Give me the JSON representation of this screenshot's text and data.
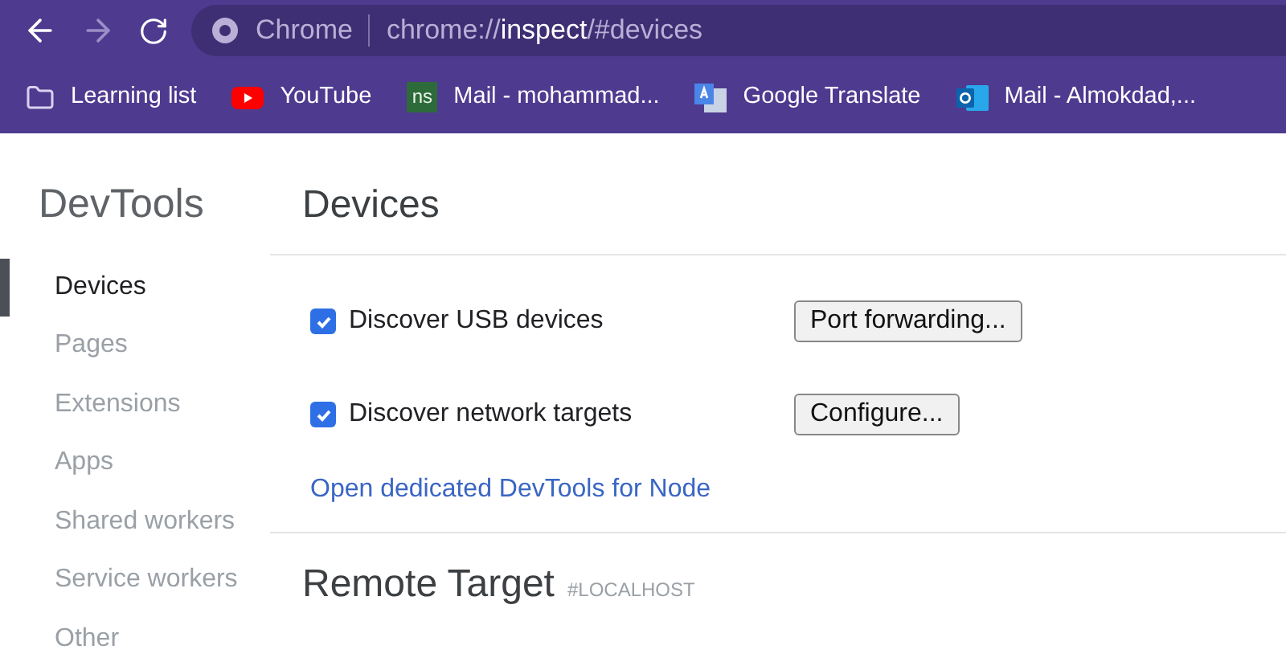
{
  "toolbar": {
    "back_enabled": true,
    "forward_enabled": false,
    "site_label": "Chrome",
    "url": {
      "prefix": "chrome://",
      "host": "inspect",
      "suffix": "/#devices"
    }
  },
  "bookmarks": [
    {
      "kind": "folder",
      "label": "Learning list"
    },
    {
      "kind": "video",
      "label": "YouTube"
    },
    {
      "kind": "badge",
      "badge": "ns",
      "label": "Mail - mohammad..."
    },
    {
      "kind": "translate",
      "label": "Google Translate"
    },
    {
      "kind": "mail",
      "label": "Mail - Almokdad,..."
    }
  ],
  "sidebar": {
    "title": "DevTools",
    "items": [
      {
        "label": "Devices",
        "selected": true
      },
      {
        "label": "Pages",
        "selected": false
      },
      {
        "label": "Extensions",
        "selected": false
      },
      {
        "label": "Apps",
        "selected": false
      },
      {
        "label": "Shared workers",
        "selected": false
      },
      {
        "label": "Service workers",
        "selected": false
      },
      {
        "label": "Other",
        "selected": false
      }
    ]
  },
  "devices": {
    "title": "Devices",
    "options": [
      {
        "label": "Discover USB devices",
        "checked": true,
        "button": "Port forwarding..."
      },
      {
        "label": "Discover network targets",
        "checked": true,
        "button": "Configure..."
      }
    ],
    "link": "Open dedicated DevTools for Node"
  },
  "remote_target": {
    "title": "Remote Target",
    "tag": "#LOCALHOST"
  }
}
